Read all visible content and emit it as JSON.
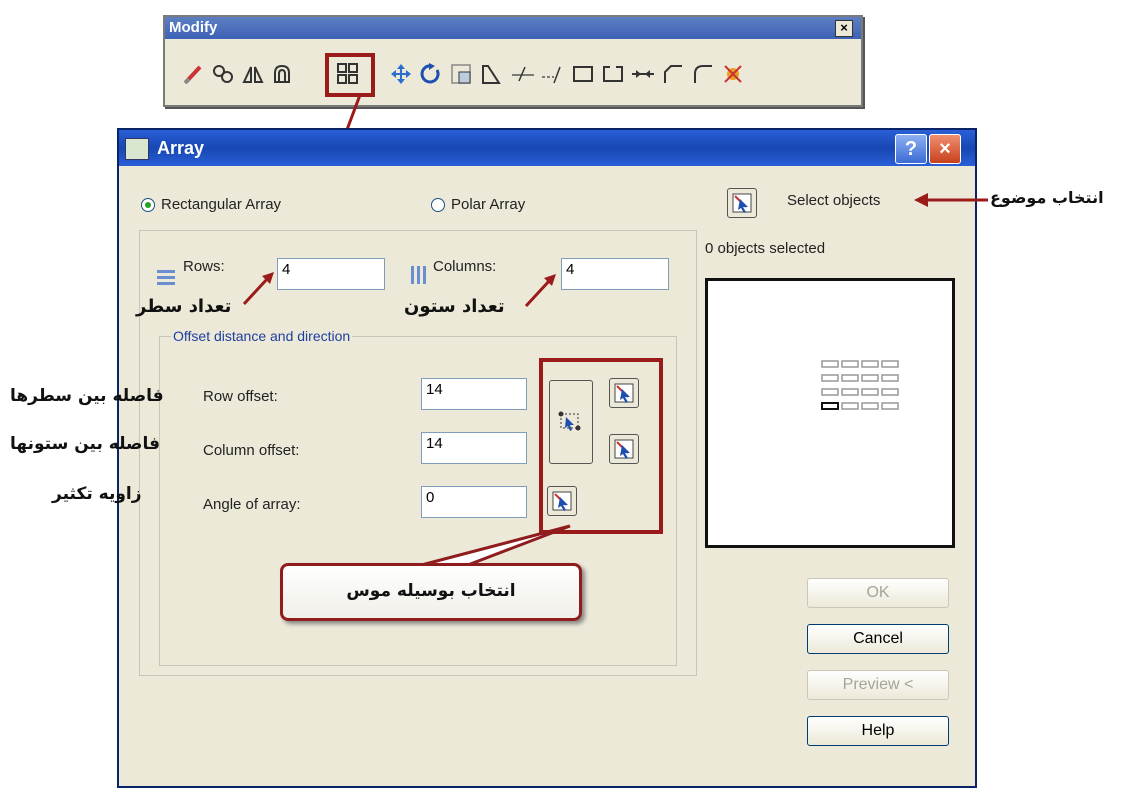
{
  "toolbar": {
    "title": "Modify",
    "close_label": "×",
    "icons": [
      "erase-icon",
      "copy-icon",
      "mirror-icon",
      "offset-icon",
      "array-icon",
      "move-icon",
      "rotate-icon",
      "scale-icon",
      "stretch-icon",
      "trim-icon",
      "extend-icon",
      "break-at-point-icon",
      "break-icon",
      "join-icon",
      "chamfer-icon",
      "fillet-icon",
      "explode-icon"
    ]
  },
  "dialog": {
    "title": "Array",
    "help_label": "?",
    "close_label": "×",
    "rectangular_label": "Rectangular Array",
    "polar_label": "Polar Array",
    "selected_mode": "Rectangular Array",
    "select_objects_label": "Select objects",
    "objects_selected": "0 objects selected",
    "rows_label": "Rows:",
    "rows_value": "4",
    "columns_label": "Columns:",
    "columns_value": "4",
    "offset_group_label": "Offset distance and direction",
    "row_offset_label": "Row offset:",
    "row_offset_value": "14",
    "column_offset_label": "Column offset:",
    "column_offset_value": "14",
    "angle_label": "Angle of array:",
    "angle_value": "0",
    "buttons": {
      "ok": "OK",
      "cancel": "Cancel",
      "preview": "Preview <",
      "help": "Help"
    }
  },
  "annotations": {
    "select_object": "انتخاب موضوع",
    "row_count": "تعداد سطر",
    "column_count": "تعداد ستون",
    "row_spacing": "فاصله بین سطرها",
    "column_spacing": "فاصله بین ستونها",
    "angle": "زاویه تکثیر",
    "mouse_select": "انتخاب بوسیله موس"
  },
  "colors": {
    "highlight": "#9b1a1a",
    "titlebar": "#1747b3",
    "dialog_bg": "#ece9d8"
  }
}
